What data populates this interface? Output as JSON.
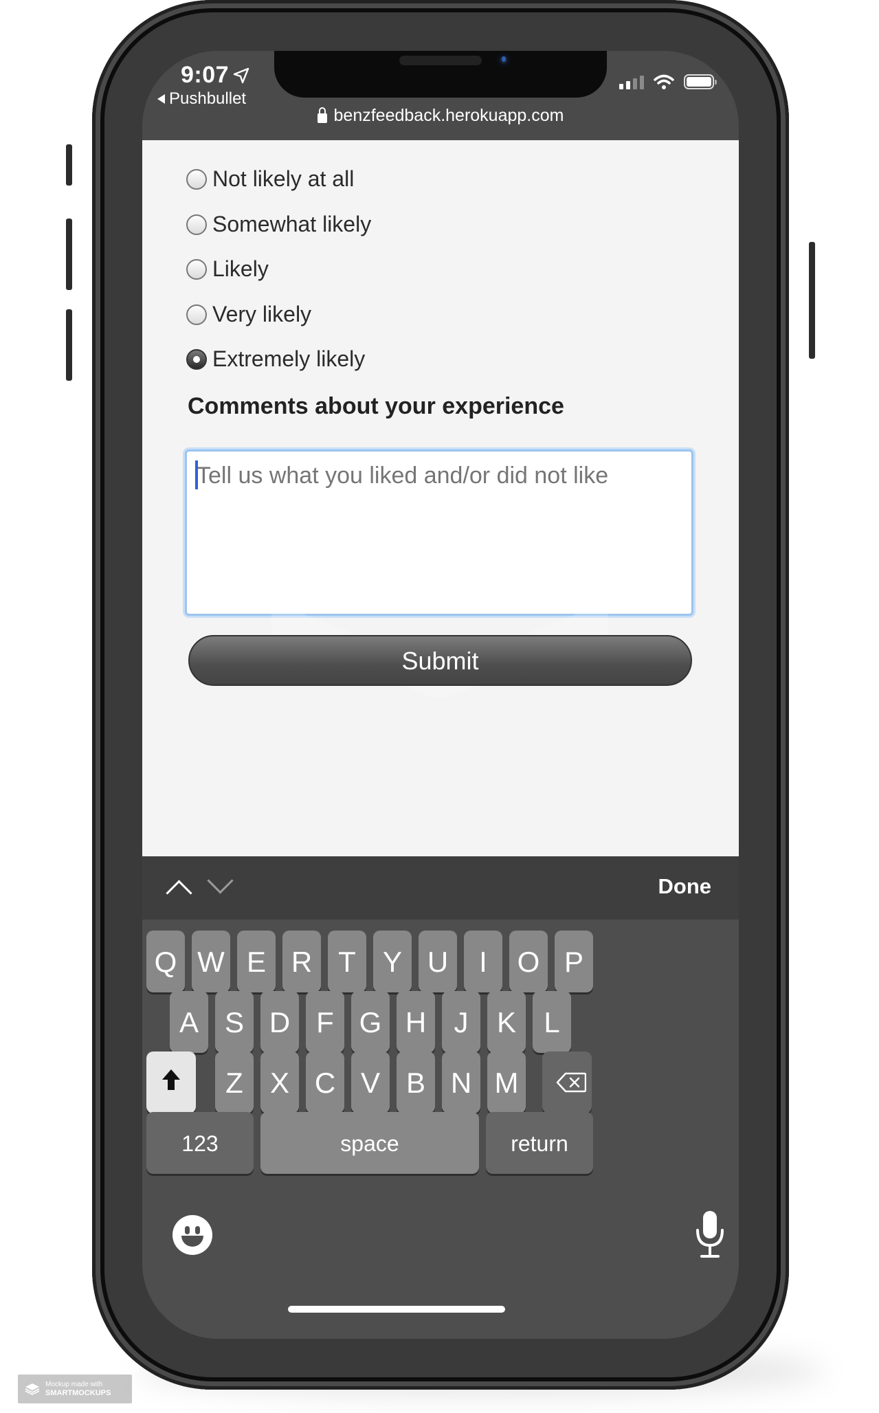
{
  "status_bar": {
    "time": "9:07",
    "back_app": "Pushbullet",
    "url": "benzfeedback.herokuapp.com"
  },
  "form": {
    "options": [
      {
        "label": "Not likely at all",
        "checked": false
      },
      {
        "label": "Somewhat likely",
        "checked": false
      },
      {
        "label": "Likely",
        "checked": false
      },
      {
        "label": "Very likely",
        "checked": false
      },
      {
        "label": "Extremely likely",
        "checked": true
      }
    ],
    "comments_heading": "Comments about your experience",
    "comments_placeholder": "Tell us what you liked and/or did not like",
    "comments_value": "",
    "submit_label": "Submit"
  },
  "keyboard_toolbar": {
    "done_label": "Done"
  },
  "keyboard": {
    "row1": [
      "Q",
      "W",
      "E",
      "R",
      "T",
      "Y",
      "U",
      "I",
      "O",
      "P"
    ],
    "row2": [
      "A",
      "S",
      "D",
      "F",
      "G",
      "H",
      "J",
      "K",
      "L"
    ],
    "row3": [
      "Z",
      "X",
      "C",
      "V",
      "B",
      "N",
      "M"
    ],
    "numbers_label": "123",
    "space_label": "space",
    "return_label": "return"
  },
  "watermark": {
    "line1": "Mockup made with",
    "line2": "SMARTMOCKUPS"
  },
  "colors": {
    "page_background": "#f4f4f4",
    "keyboard_background": "#4e4e4e",
    "focus_ring": "#9cc4ee",
    "caret": "#2c62d9"
  }
}
